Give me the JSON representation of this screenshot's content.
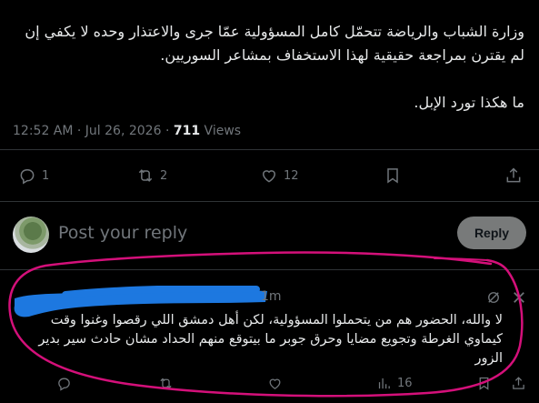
{
  "tweet": {
    "text_line1": "وزارة الشباب والرياضة تتحمّل كامل المسؤولية عمّا جرى والاعتذار وحده لا يكفي إن",
    "text_line2": "لم يقترن بمراجعة حقيقية لهذا الاستخفاف بمشاعر السوريين.",
    "text_line3": "ما هكذا تورد الإبل.",
    "timestamp": "12:52 AM · Jul 26, 2026",
    "separator": " · ",
    "views_count": "711",
    "views_label": " Views"
  },
  "actions": {
    "replies": "1",
    "reposts": "2",
    "likes": "12"
  },
  "reply_box": {
    "placeholder": "Post your reply",
    "button_label": "Reply"
  },
  "comment": {
    "time": "1m",
    "text_line1": "لا والله، الحضور هم من يتحملوا المسؤولية، لكن أهل دمشق اللي رقصوا وغنوا وقت",
    "text_line2": "كيماوي الغرطة وتجويع مضايا وحرق جوبر ما بيتوقع منهم الحداد مشان حادث سير بدير",
    "text_line3": "الزور",
    "views": "16"
  },
  "colors": {
    "background": "#000000",
    "text": "#e7e9ea",
    "muted": "#71767b",
    "annotation": "#d4107a",
    "redaction": "#1d78e0"
  },
  "icons": [
    "reply-icon",
    "repost-icon",
    "like-icon",
    "bookmark-icon",
    "share-icon",
    "grok-icon",
    "more-icon",
    "views-icon"
  ]
}
